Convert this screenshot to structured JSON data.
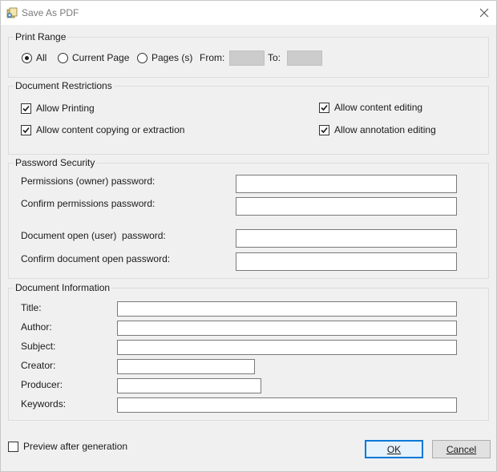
{
  "window": {
    "title": "Save As PDF"
  },
  "print_range": {
    "legend": "Print Range",
    "options": {
      "all": "All",
      "current": "Current Page",
      "pages": "Pages (s)"
    },
    "selected": "all",
    "from_label": "From:",
    "to_label": "To:"
  },
  "restrictions": {
    "legend": "Document Restrictions",
    "allow_printing": "Allow Printing",
    "allow_copying": "Allow content copying or extraction",
    "allow_editing": "Allow content editing",
    "allow_annotation": "Allow annotation editing"
  },
  "password": {
    "legend": "Password Security",
    "owner_label": "Permissions (owner) password:",
    "confirm_owner_label": "Confirm permissions password:",
    "user_label": "Document open (user)  password:",
    "confirm_user_label": "Confirm document open password:"
  },
  "info": {
    "legend": "Document Information",
    "title_label": "Title:",
    "author_label": "Author:",
    "subject_label": "Subject:",
    "creator_label": "Creator:",
    "producer_label": "Producer:",
    "keywords_label": "Keywords:"
  },
  "footer": {
    "preview_label": "Preview after generation",
    "ok": "OK",
    "cancel": "Cancel"
  }
}
